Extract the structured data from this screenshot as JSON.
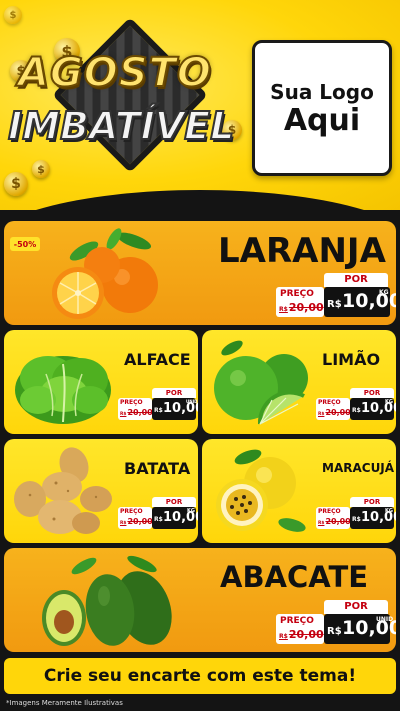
{
  "header": {
    "title_line1": "AGOSTO",
    "title_line2": "IMBATÍVEL",
    "logo_line1": "Sua Logo",
    "logo_line2": "Aqui",
    "coin_symbol": "$"
  },
  "colors": {
    "yellow": "#ffd60a",
    "orange": "#f19a10",
    "price_red": "#c40010",
    "dark": "#141414"
  },
  "products": [
    {
      "name": "LARANJA",
      "badge": "-50%",
      "por_label": "POR",
      "preco_label": "PREÇO",
      "old_currency": "R$",
      "old_price": "20,00",
      "new_currency": "R$",
      "new_price": "10,00",
      "unit": "KG"
    },
    {
      "name": "ALFACE",
      "por_label": "POR",
      "preco_label": "PREÇO",
      "old_currency": "R$",
      "old_price": "20,00",
      "new_currency": "R$",
      "new_price": "10,00",
      "unit": "UNID"
    },
    {
      "name": "LIMÃO",
      "por_label": "POR",
      "preco_label": "PREÇO",
      "old_currency": "R$",
      "old_price": "20,00",
      "new_currency": "R$",
      "new_price": "10,00",
      "unit": "KG"
    },
    {
      "name": "BATATA",
      "por_label": "POR",
      "preco_label": "PREÇO",
      "old_currency": "R$",
      "old_price": "20,00",
      "new_currency": "R$",
      "new_price": "10,00",
      "unit": "KG"
    },
    {
      "name": "MARACUJÁ",
      "por_label": "POR",
      "preco_label": "PREÇO",
      "old_currency": "R$",
      "old_price": "20,00",
      "new_currency": "R$",
      "new_price": "10,00",
      "unit": "KG"
    },
    {
      "name": "ABACATE",
      "por_label": "POR",
      "preco_label": "PREÇO",
      "old_currency": "R$",
      "old_price": "20,00",
      "new_currency": "R$",
      "new_price": "10,00",
      "unit": "UNID"
    }
  ],
  "footer": {
    "cta": "Crie seu encarte com este tema!",
    "note": "*Imagens Meramente Ilustrativas"
  }
}
